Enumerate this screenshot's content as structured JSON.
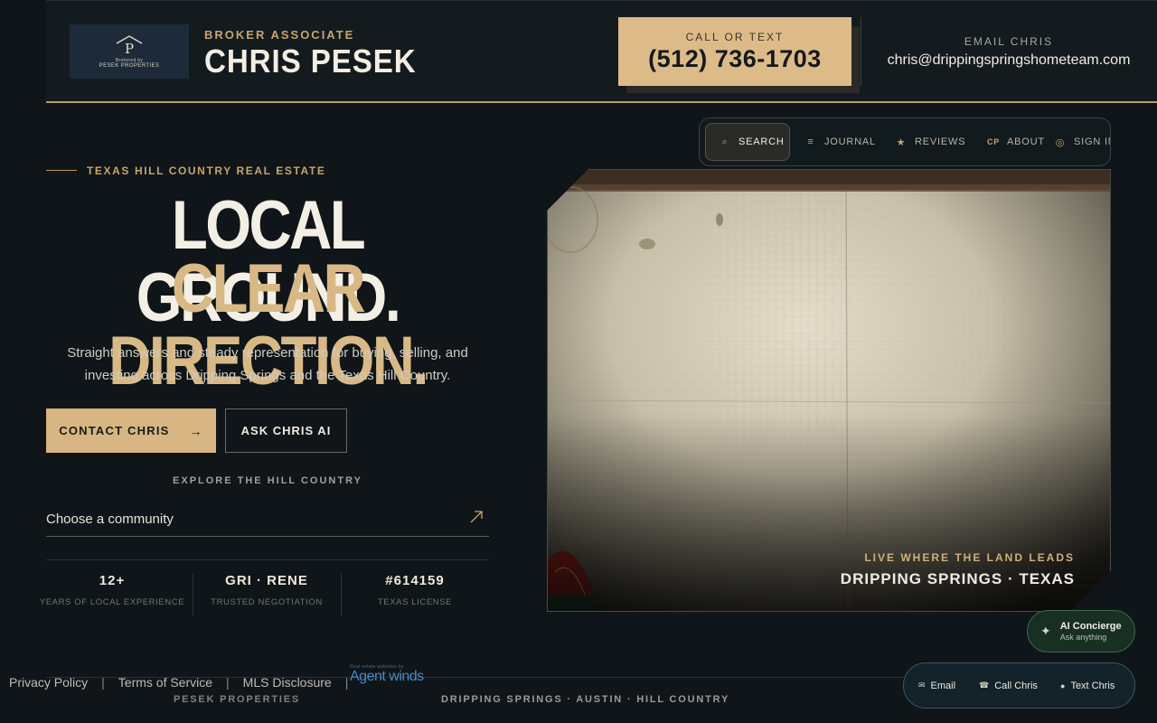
{
  "header": {
    "logo": {
      "tagline": "Brokered by",
      "brand": "PESEK PROPERTIES",
      "monogram": "P"
    },
    "role": "BROKER ASSOCIATE",
    "name": "CHRIS PESEK",
    "call_label": "CALL OR TEXT",
    "phone": "(512) 736-1703",
    "email_label": "EMAIL CHRIS",
    "email": "chris@drippingspringshometeam.com"
  },
  "nav": {
    "items": [
      {
        "label": "SEARCH",
        "icon": "search-icon",
        "active": true
      },
      {
        "label": "JOURNAL",
        "icon": "journal-icon"
      },
      {
        "label": "REVIEWS",
        "icon": "star-icon"
      },
      {
        "label": "ABOUT",
        "icon": "cp-monogram-icon",
        "icon_text": "CP"
      },
      {
        "label": "SIGN IN",
        "icon": "user-icon"
      }
    ]
  },
  "hero": {
    "eyebrow": "TEXAS HILL COUNTRY REAL ESTATE",
    "headline_1": "LOCAL GROUND.",
    "headline_2": "CLEAR DIRECTION.",
    "lead": "Straight answers and steady representation for buying, selling, and investing across Dripping Springs and the Texas Hill Country.",
    "contact_btn": "CONTACT CHRIS",
    "contact_arrow": "→",
    "ask_btn": "ASK CHRIS AI",
    "explore_label": "EXPLORE THE HILL COUNTRY",
    "community_select": {
      "value": "Choose a community",
      "icon": "arrow-up-right-icon"
    }
  },
  "stats": [
    {
      "value": "12+",
      "label": "YEARS OF LOCAL EXPERIENCE"
    },
    {
      "value": "GRI · RENE",
      "label": "TRUSTED NEGOTIATION"
    },
    {
      "value": "#614159",
      "label": "TEXAS LICENSE"
    }
  ],
  "photo": {
    "caption_1": "LIVE WHERE THE LAND LEADS",
    "caption_2": "DRIPPING SPRINGS · TEXAS"
  },
  "ai_concierge": {
    "title": "AI Concierge",
    "subtitle": "Ask anything"
  },
  "contact_bar": {
    "email": "Email",
    "call": "Call Chris",
    "text": "Text Chris"
  },
  "footer": {
    "links": [
      "Privacy Policy",
      "Terms of Service",
      "MLS Disclosure"
    ],
    "separator": "|",
    "agentwinds_small": "Real estate websites by",
    "agentwinds": "Agent winds",
    "brand": "PESEK PROPERTIES",
    "locations": "DRIPPING SPRINGS · AUSTIN · HILL COUNTRY"
  },
  "colors": {
    "background": "#0f1518",
    "gold": "#d7b683",
    "accent_text": "#c8a46e",
    "concierge": "#183024"
  }
}
